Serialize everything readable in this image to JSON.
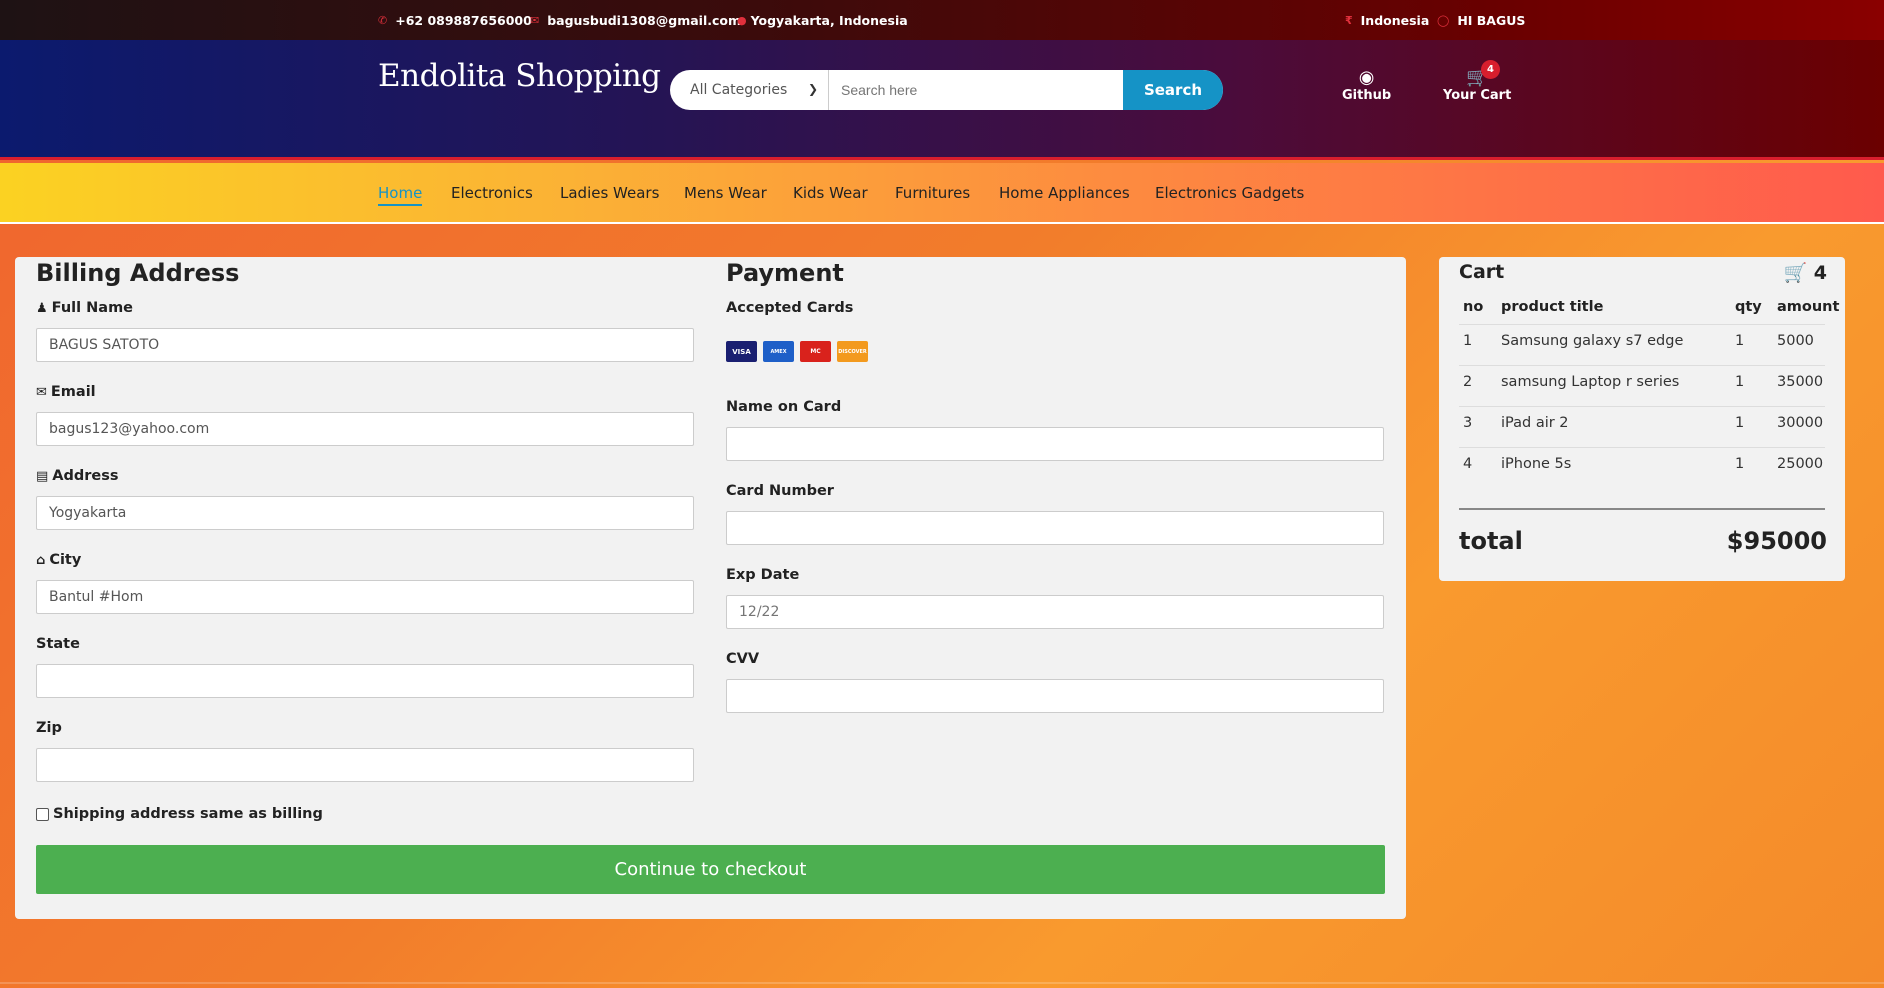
{
  "topbar": {
    "phone": "+62 089887656000",
    "email": "bagusbudi1308@gmail.com",
    "location": "Yogyakarta, Indonesia",
    "language": "Indonesia",
    "user": "HI BAGUS"
  },
  "header": {
    "logo": "Endolita Shopping",
    "category_select": "All Categories",
    "search_placeholder": "Search here",
    "search_button": "Search",
    "github_label": "Github",
    "cart_label": "Your Cart",
    "cart_count": "4"
  },
  "nav": {
    "items": [
      "Home",
      "Electronics",
      "Ladies Wears",
      "Mens Wear",
      "Kids Wear",
      "Furnitures",
      "Home Appliances",
      "Electronics Gadgets"
    ],
    "active": "Home"
  },
  "billing": {
    "title": "Billing Address",
    "full_name_label": "Full Name",
    "full_name_value": "BAGUS SATOTO",
    "email_label": "Email",
    "email_value": "bagus123@yahoo.com",
    "address_label": "Address",
    "address_value": "Yogyakarta",
    "city_label": "City",
    "city_value": "Bantul #Hom",
    "state_label": "State",
    "state_value": "",
    "zip_label": "Zip",
    "zip_value": "",
    "shipping_checkbox_label": "Shipping address same as billing"
  },
  "payment": {
    "title": "Payment",
    "accepted_cards_label": "Accepted Cards",
    "card_brands": [
      "VISA",
      "AMEX",
      "MC",
      "DISCOVER"
    ],
    "name_on_card_label": "Name on Card",
    "card_number_label": "Card Number",
    "exp_date_label": "Exp Date",
    "exp_date_placeholder": "12/22",
    "cvv_label": "CVV"
  },
  "checkout_button": "Continue to checkout",
  "cart": {
    "title": "Cart",
    "count": "4",
    "headers": [
      "no",
      "product title",
      "qty",
      "amount"
    ],
    "rows": [
      {
        "no": "1",
        "title": "Samsung galaxy s7 edge",
        "qty": "1",
        "amount": "5000"
      },
      {
        "no": "2",
        "title": "samsung Laptop r series",
        "qty": "1",
        "amount": "35000"
      },
      {
        "no": "3",
        "title": "iPad air 2",
        "qty": "1",
        "amount": "30000"
      },
      {
        "no": "4",
        "title": "iPhone 5s",
        "qty": "1",
        "amount": "25000"
      }
    ],
    "total_label": "total",
    "total_value": "$95000"
  },
  "colors": {
    "accent": "#1593c6",
    "badge": "#d81e2d",
    "checkout": "#4caf50"
  }
}
